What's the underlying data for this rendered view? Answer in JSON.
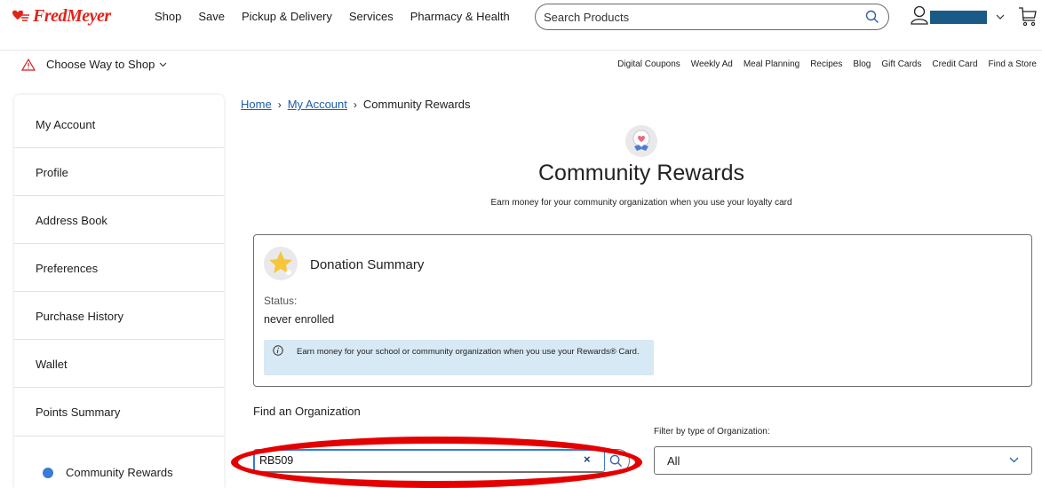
{
  "brand": {
    "name": "FredMeyer",
    "color": "#e2231a"
  },
  "nav": [
    {
      "label": "Shop"
    },
    {
      "label": "Save"
    },
    {
      "label": "Pickup & Delivery"
    },
    {
      "label": "Services"
    },
    {
      "label": "Pharmacy & Health"
    }
  ],
  "search": {
    "placeholder": "Search Products",
    "icon": "search-icon"
  },
  "account": {
    "icon": "user-icon",
    "menu_icon": "chevron-down-icon",
    "cart_icon": "cart-icon"
  },
  "subbar": {
    "choose_way": "Choose Way to Shop",
    "warning_icon": "warning-icon",
    "links": [
      {
        "label": "Digital Coupons"
      },
      {
        "label": "Weekly Ad"
      },
      {
        "label": "Meal Planning"
      },
      {
        "label": "Recipes"
      },
      {
        "label": "Blog"
      },
      {
        "label": "Gift Cards"
      },
      {
        "label": "Credit Card"
      },
      {
        "label": "Find a Store"
      }
    ]
  },
  "sidebar": {
    "items": [
      {
        "label": "My Account"
      },
      {
        "label": "Profile"
      },
      {
        "label": "Address Book"
      },
      {
        "label": "Preferences"
      },
      {
        "label": "Purchase History"
      },
      {
        "label": "Wallet"
      },
      {
        "label": "Points Summary"
      }
    ],
    "active": {
      "label": "Community Rewards",
      "dot_color": "#3b7bd8"
    }
  },
  "breadcrumb": {
    "home": "Home",
    "my_account": "My Account",
    "current": "Community Rewards",
    "separator": "›"
  },
  "page": {
    "title": "Community Rewards",
    "subtitle": "Earn money for your community organization when you use your loyalty card"
  },
  "donation": {
    "title": "Donation Summary",
    "status_label": "Status:",
    "status_value": "never enrolled",
    "info": "Earn money for your school or community organization when you use your Rewards® Card.",
    "info_color": "#d8e9f6"
  },
  "find": {
    "title": "Find an Organization",
    "search_value": "RB509",
    "clear_label": "×",
    "filter_label": "Filter by type of Organization:",
    "filter_value": "All",
    "highlight_color": "#e50000"
  }
}
